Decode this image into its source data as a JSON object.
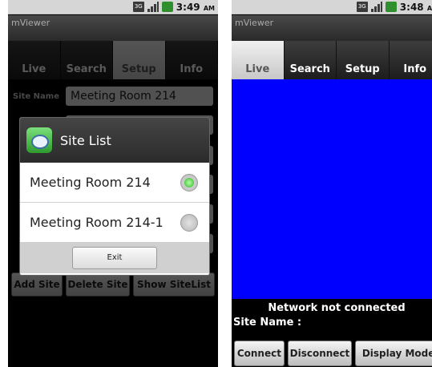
{
  "left": {
    "status_time": "3:49",
    "status_ampm": "AM",
    "app_title": "mViewer",
    "tabs": [
      "Live",
      "Search",
      "Setup",
      "Info"
    ],
    "active_tab": "Setup",
    "site_name_label": "Site Name",
    "site_name_value": "Meeting Room 214",
    "buttons": [
      "Add Site",
      "Delete Site",
      "Show SiteList"
    ],
    "dialog": {
      "title": "Site List",
      "items": [
        {
          "label": "Meeting Room 214",
          "selected": true
        },
        {
          "label": "Meeting Room 214-1",
          "selected": false
        }
      ],
      "exit_label": "Exit"
    }
  },
  "right": {
    "status_time": "3:48",
    "status_ampm": "AM",
    "app_title": "mViewer",
    "tabs": [
      "Live",
      "Search",
      "Setup",
      "Info"
    ],
    "active_tab": "Live",
    "status_message": "Network not connected",
    "site_name_label": "Site Name :",
    "buttons": [
      "Connect",
      "Disconnect",
      "Display Mode"
    ]
  },
  "colors": {
    "video_bg": "#0000ff",
    "radio_on": "#2db42d"
  }
}
